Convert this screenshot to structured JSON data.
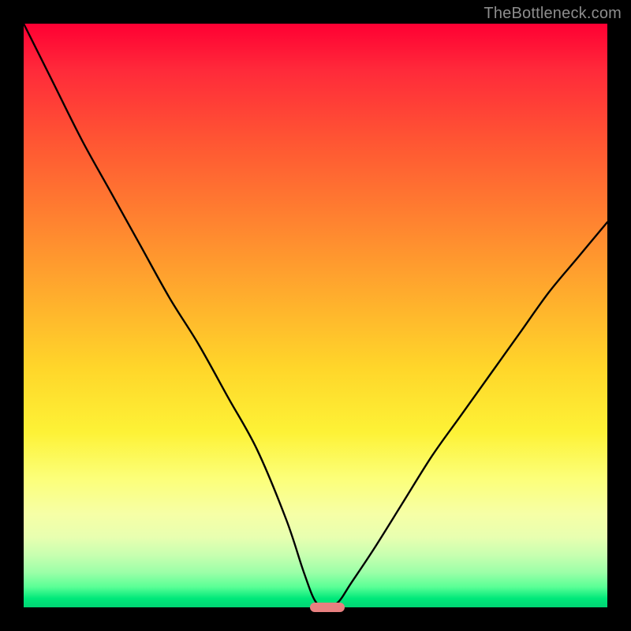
{
  "watermark": "TheBottleneck.com",
  "colors": {
    "background": "#000000",
    "watermark": "#8d8d8d",
    "curve": "#000000",
    "marker": "#e88080"
  },
  "chart_data": {
    "type": "line",
    "title": "",
    "xlabel": "",
    "ylabel": "",
    "xlim": [
      0,
      100
    ],
    "ylim": [
      0,
      100
    ],
    "grid": false,
    "legend": false,
    "series": [
      {
        "name": "bottleneck-curve",
        "x": [
          0,
          5,
          10,
          15,
          20,
          25,
          30,
          35,
          40,
          45,
          48,
          50,
          52,
          54,
          56,
          60,
          65,
          70,
          75,
          80,
          85,
          90,
          95,
          100
        ],
        "values": [
          100,
          90,
          80,
          71,
          62,
          53,
          45,
          36,
          27,
          15,
          6,
          1,
          0,
          1,
          4,
          10,
          18,
          26,
          33,
          40,
          47,
          54,
          60,
          66
        ]
      }
    ],
    "annotations": [
      {
        "name": "best-match-marker",
        "shape": "pill",
        "x": 52,
        "y": 0,
        "width_pct": 6,
        "height_pct": 1.6
      }
    ]
  }
}
